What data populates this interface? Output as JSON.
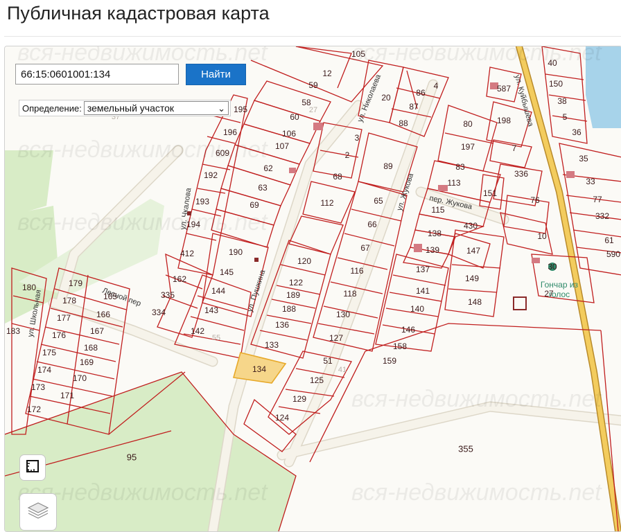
{
  "page": {
    "title": "Публичная кадастровая карта"
  },
  "search": {
    "value": "66:15:0601001:134",
    "button_label": "Найти"
  },
  "definition": {
    "label": "Определение:",
    "selected": "земельный участок"
  },
  "map": {
    "watermark": "вся-недвижимость.net",
    "selected_plot": "134",
    "streets": [
      {
        "id": "kuibysheva",
        "name": "ул. Куйбышева"
      },
      {
        "id": "zhukova-street",
        "name": "ул. Жукова"
      },
      {
        "id": "zhukova-lane",
        "name": "пер. Жукова"
      },
      {
        "id": "nikolaeva",
        "name": "ул. Николаева"
      },
      {
        "id": "pushkina",
        "name": "ул. Пушкина"
      },
      {
        "id": "chkalova",
        "name": "ул. Чкалова"
      },
      {
        "id": "lesnoy",
        "name": "Лесной пер"
      },
      {
        "id": "shkolnaya",
        "name": "ул. Школьная"
      }
    ],
    "poi": {
      "name_line1": "Гончар из",
      "name_line2": "голос",
      "code": "27"
    },
    "plots": [
      "105",
      "12",
      "59",
      "58",
      "27",
      "60",
      "106",
      "107",
      "62",
      "63",
      "69",
      "195",
      "196",
      "609",
      "192",
      "193",
      "194",
      "412",
      "190",
      "145",
      "144",
      "143",
      "142",
      "162",
      "335",
      "334",
      "180",
      "179",
      "178",
      "177",
      "176",
      "175",
      "174",
      "173",
      "172",
      "171",
      "170",
      "169",
      "168",
      "167",
      "166",
      "165",
      "183",
      "20",
      "86",
      "4",
      "87",
      "88",
      "3",
      "2",
      "89",
      "68",
      "112",
      "65",
      "66",
      "67",
      "116",
      "118",
      "130",
      "127",
      "120",
      "122",
      "189",
      "188",
      "136",
      "133",
      "134",
      "51",
      "125",
      "129",
      "124",
      "41",
      "80",
      "198",
      "197",
      "83",
      "113",
      "115",
      "138",
      "139",
      "430",
      "137",
      "141",
      "140",
      "146",
      "158",
      "159",
      "151",
      "147",
      "149",
      "148",
      "587",
      "7",
      "336",
      "76",
      "10",
      "30",
      "40",
      "150",
      "38",
      "5",
      "36",
      "35",
      "33",
      "77",
      "332",
      "61",
      "590",
      "55",
      "37",
      "95",
      "355"
    ]
  },
  "tools": [
    {
      "name": "measure-icon"
    },
    {
      "name": "layers-icon"
    }
  ],
  "colors": {
    "parcel_border": "#c01e1e",
    "parcel_selected_fill": "#f6d68a",
    "parcel_selected_border": "#e7a92a",
    "road_fill": "#f6f3ea",
    "road_border": "#ddd7c8",
    "forest": "#d8ecc6",
    "water": "#a7d3ea",
    "highway": "#f3cc5e",
    "button_blue": "#1a73c8"
  }
}
